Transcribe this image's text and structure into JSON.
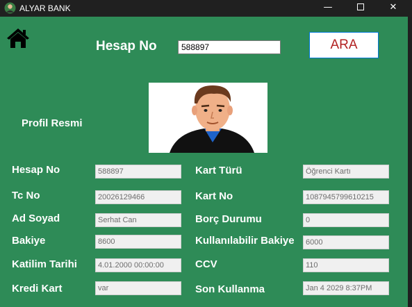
{
  "window": {
    "title": "ALYAR BANK",
    "icon": "bank-app-icon",
    "minimize_glyph": "—",
    "close_glyph": "✕"
  },
  "colors": {
    "background": "#2e8b57",
    "titlebar": "#202020",
    "search_button_text": "#b22222",
    "search_button_border": "#0078d7"
  },
  "search": {
    "label": "Hesap No",
    "value": "588897",
    "button_label": "ARA"
  },
  "home": {
    "icon": "home-icon"
  },
  "profile": {
    "label": "Profil Resmi",
    "image": "person-avatar-illustration"
  },
  "fields_left": [
    {
      "label": "Hesap No",
      "value": "588897"
    },
    {
      "label": "Tc No",
      "value": "20026129466"
    },
    {
      "label": "Ad Soyad",
      "value": "Serhat Can"
    },
    {
      "label": "Bakiye",
      "value": "8600"
    },
    {
      "label": "Katilim Tarihi",
      "value": "4.01.2000 00:00:00"
    },
    {
      "label": "Kredi Kart",
      "value": "var"
    }
  ],
  "fields_right": [
    {
      "label": "Kart Türü",
      "value": "Öğrenci Kartı"
    },
    {
      "label": "Kart No",
      "value": "1087945799610215"
    },
    {
      "label": "Borç Durumu",
      "value": "0"
    },
    {
      "label": "Kullanılabilir Bakiye",
      "value": "6000"
    },
    {
      "label": "CCV",
      "value": "110"
    },
    {
      "label": "Son Kullanma",
      "value": "Jan  4 2029  8:37PM"
    }
  ]
}
